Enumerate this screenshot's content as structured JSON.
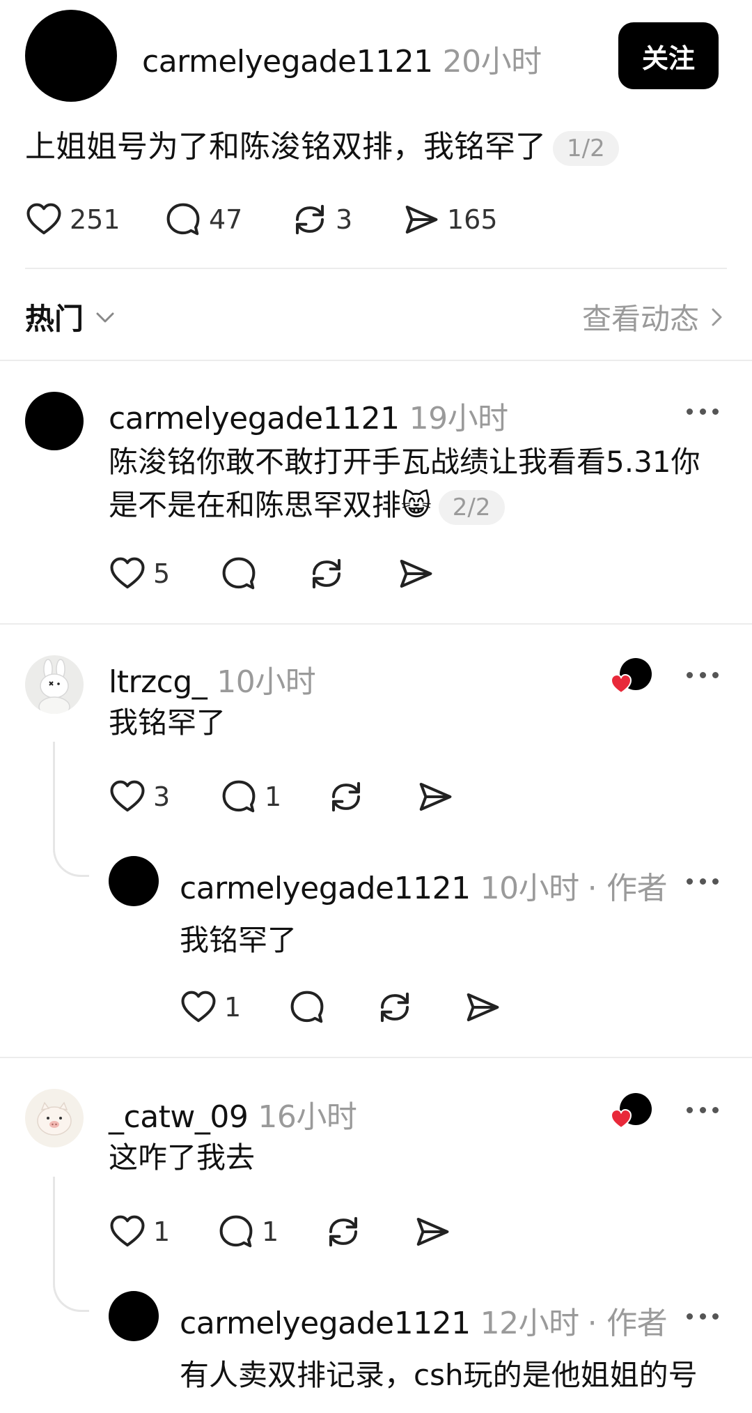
{
  "post": {
    "username": "carmelyegade1121",
    "time": "20小时",
    "follow_label": "关注",
    "text": "上姐姐号为了和陈浚铭双排，我铭罕了",
    "counter": "1/2",
    "likes": "251",
    "comments": "47",
    "reposts": "3",
    "shares": "165"
  },
  "sort": {
    "label": "热门",
    "view_activity": "查看动态"
  },
  "thread1": {
    "username": "carmelyegade1121",
    "time": "19小时",
    "text": "陈浚铭你敢不敢打开手瓦战绩让我看看5.31你是不是在和陈思罕双排😸",
    "counter": "2/2",
    "likes": "5"
  },
  "comment1": {
    "username": "ltrzcg_",
    "time": "10小时",
    "text": "我铭罕了",
    "likes": "3",
    "comments": "1",
    "reply": {
      "username": "carmelyegade1121",
      "time": "10小时",
      "author_tag": "作者",
      "text": "我铭罕了",
      "likes": "1"
    }
  },
  "comment2": {
    "username": "_catw_09",
    "time": "16小时",
    "text": "这咋了我去",
    "likes": "1",
    "comments": "1",
    "reply": {
      "username": "carmelyegade1121",
      "time": "12小时",
      "author_tag": "作者",
      "text": "有人卖双排记录，csh玩的是他姐姐的号"
    }
  },
  "icons": {
    "like": "heart-icon",
    "comment": "comment-bubble-icon",
    "repost": "repost-icon",
    "share": "send-icon",
    "more": "more-dots-icon",
    "chevron": "chevron-icon"
  },
  "colors": {
    "heart_red": "#e8293a",
    "muted_gray": "#9a9a9a",
    "button_black": "#000000"
  }
}
